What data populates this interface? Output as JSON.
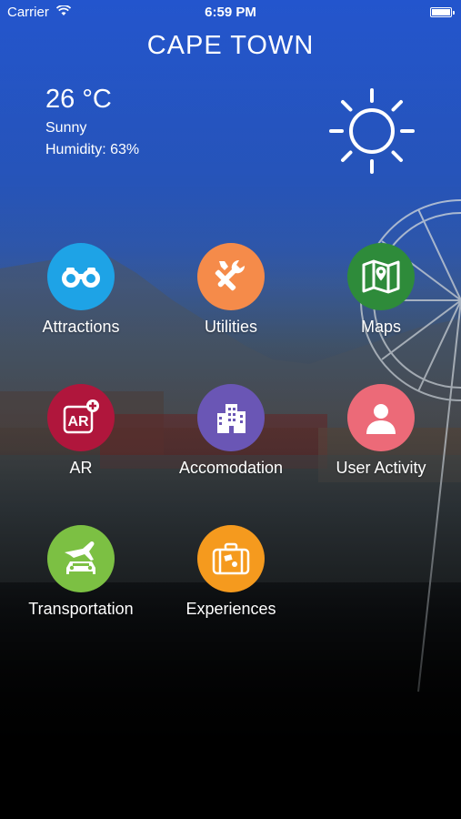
{
  "status_bar": {
    "carrier": "Carrier",
    "time": "6:59 PM"
  },
  "header": {
    "city": "CAPE TOWN"
  },
  "weather": {
    "temperature": "26 °C",
    "condition": "Sunny",
    "humidity": "Humidity: 63%",
    "icon": "sun-icon"
  },
  "menu": {
    "attractions": {
      "label": "Attractions",
      "color": "#1ea3e6",
      "icon": "binoculars-icon"
    },
    "utilities": {
      "label": "Utilities",
      "color": "#f58b4a",
      "icon": "tools-icon"
    },
    "maps": {
      "label": "Maps",
      "color": "#2e8b3a",
      "icon": "map-icon"
    },
    "ar": {
      "label": "AR",
      "color": "#b0163c",
      "icon": "ar-icon"
    },
    "accomodation": {
      "label": "Accomodation",
      "color": "#6a56b5",
      "icon": "building-icon"
    },
    "user_activity": {
      "label": "User Activity",
      "color": "#ec6a78",
      "icon": "user-icon"
    },
    "transportation": {
      "label": "Transportation",
      "color": "#7cc043",
      "icon": "plane-car-icon"
    },
    "experiences": {
      "label": "Experiences",
      "color": "#f59a1e",
      "icon": "suitcase-icon"
    }
  }
}
